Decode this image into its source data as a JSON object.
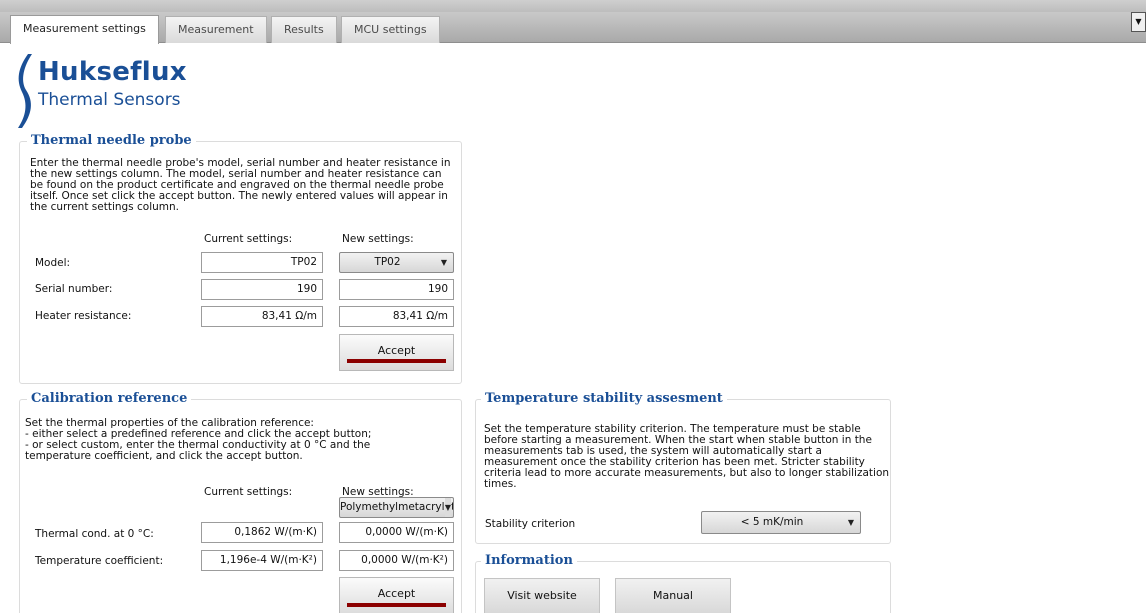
{
  "tabs": [
    {
      "label": "Measurement settings",
      "active": true
    },
    {
      "label": "Measurement",
      "active": false
    },
    {
      "label": "Results",
      "active": false
    },
    {
      "label": "MCU settings",
      "active": false
    }
  ],
  "corner_button_icon": "chevron-down-icon",
  "logo": {
    "name": "Hukseflux",
    "subtitle": "Thermal Sensors",
    "color": "#1a4f96"
  },
  "thermal_needle_probe": {
    "title": "Thermal needle probe",
    "description": [
      "Enter the thermal needle probe's model, serial number and heater resistance in",
      "the new settings column. The model, serial number and heater resistance can",
      "be found on the product certificate and engraved on the thermal needle probe",
      "itself. Once set click the accept button. The newly entered values will appear in",
      "the current settings column."
    ],
    "current_header": "Current settings:",
    "new_header": "New settings:",
    "rows": [
      {
        "label": "Model:",
        "current": "TP02",
        "new": "TP02"
      },
      {
        "label": "Serial number:",
        "current": "190",
        "new": "190"
      },
      {
        "label": "Heater resistance:",
        "current": "83,41 Ω/m",
        "new": "83,41 Ω/m"
      }
    ],
    "accept_label": "Accept"
  },
  "calibration_reference": {
    "title": "Calibration reference",
    "description": [
      "Set the thermal properties of the calibration reference:",
      "- either select a predefined reference and click the accept button;",
      "- or select custom, enter the thermal conductivity at 0 °C and the",
      "temperature coefficient, and click the accept button."
    ],
    "current_header": "Current settings:",
    "new_header": "New settings:",
    "reference_select": "Polymethylmetacrylate",
    "rows": [
      {
        "label": "Thermal cond. at 0 °C:",
        "current": "0,1862 W/(m·K)",
        "new": "0,0000 W/(m·K)"
      },
      {
        "label": "Temperature coefficient:",
        "current": "1,196e-4 W/(m·K²)",
        "new": "0,0000 W/(m·K²)"
      }
    ],
    "accept_label": "Accept"
  },
  "temperature_stability": {
    "title": "Temperature stability assesment",
    "description": [
      "Set the temperature stability criterion. The temperature must be stable",
      "before starting a measurement. When the start when stable button in the",
      "measurements tab is used, the system will automatically start a",
      "measurement once the stability criterion has been met. Stricter stability",
      "criteria lead to more accurate measurements, but also to longer stabilization",
      "times."
    ],
    "criterion_label": "Stability criterion",
    "criterion_value": "< 5 mK/min"
  },
  "information": {
    "title": "Information",
    "visit_website_label": "Visit website",
    "manual_label": "Manual"
  },
  "colors": {
    "accent": "#1a4f96",
    "accept_bar": "#8b0000"
  }
}
